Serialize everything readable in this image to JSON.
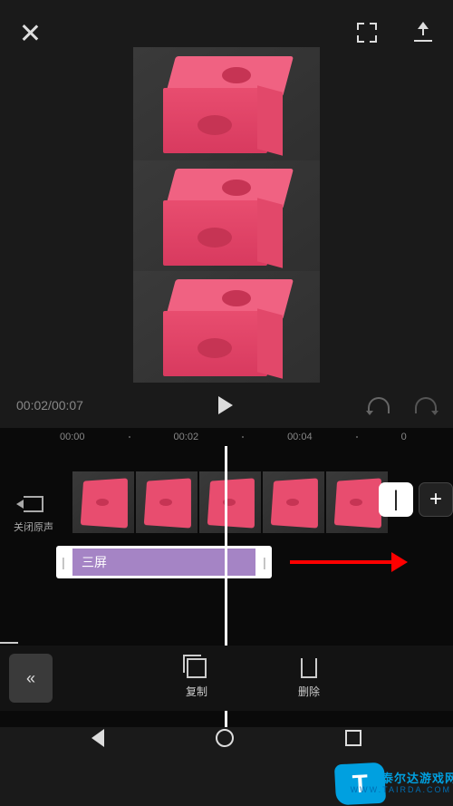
{
  "topbar": {
    "close": "close",
    "expand": "expand",
    "export": "export"
  },
  "controls": {
    "current_time": "00:02",
    "total_time": "00:07",
    "separator": "/",
    "play": "play",
    "undo": "undo",
    "redo": "redo"
  },
  "ruler": {
    "marks": [
      "00:00",
      "00:02",
      "00:04",
      "0"
    ]
  },
  "timeline": {
    "mute_label": "关闭原声",
    "effect_label": "三屏",
    "end_buttons": {
      "split": "|",
      "add": "+"
    }
  },
  "bottombar": {
    "collapse": "《",
    "copy_label": "复制",
    "delete_label": "删除"
  },
  "watermark": {
    "main": "泰尔达游戏网",
    "sub": "WWW.TAIRDA.COM"
  }
}
